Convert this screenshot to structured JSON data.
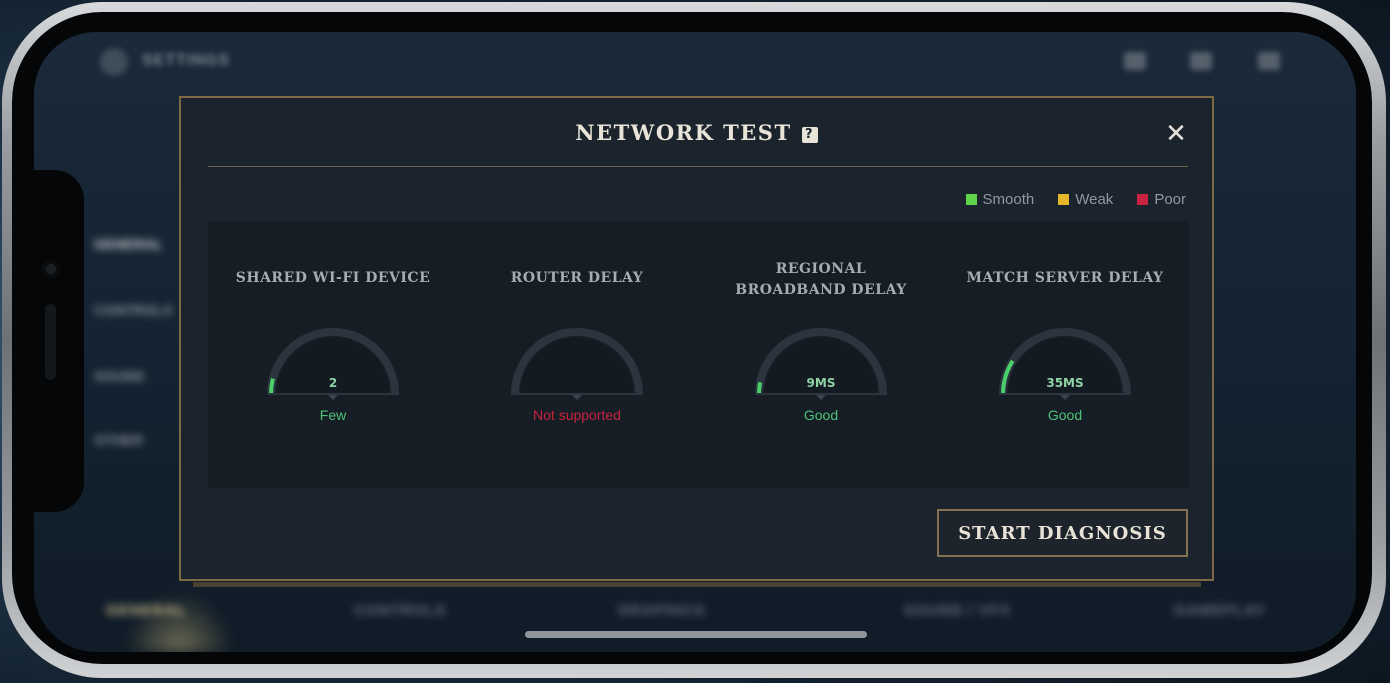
{
  "background": {
    "title": "SETTINGS",
    "sidebar": [
      "GENERAL",
      "CONTROLS",
      "SOUND",
      "OTHER"
    ],
    "tabs": [
      "GENERAL",
      "CONTROLS",
      "GRAPHICS",
      "SOUND / VFX",
      "GAMEPLAY"
    ]
  },
  "dialog": {
    "title": "NETWORK TEST",
    "help_icon": "?",
    "close_icon": "✕",
    "legend": [
      {
        "label": "Smooth",
        "color": "#5fd34a"
      },
      {
        "label": "Weak",
        "color": "#e6b62b"
      },
      {
        "label": "Poor",
        "color": "#c8233f"
      }
    ],
    "metrics": [
      {
        "title": "SHARED WI-FI DEVICE",
        "value": "2",
        "status": "Few",
        "status_color": "#4ec27a",
        "level": 0.08
      },
      {
        "title": "ROUTER DELAY",
        "value": "",
        "status": "Not supported",
        "status_color": "#c8233f",
        "level": 0
      },
      {
        "title": "REGIONAL\nBROADBAND DELAY",
        "value": "9MS",
        "status": "Good",
        "status_color": "#4ec27a",
        "level": 0.06
      },
      {
        "title": "MATCH SERVER DELAY",
        "value": "35MS",
        "status": "Good",
        "status_color": "#4ec27a",
        "level": 0.18
      }
    ],
    "start_button": "START DIAGNOSIS"
  }
}
